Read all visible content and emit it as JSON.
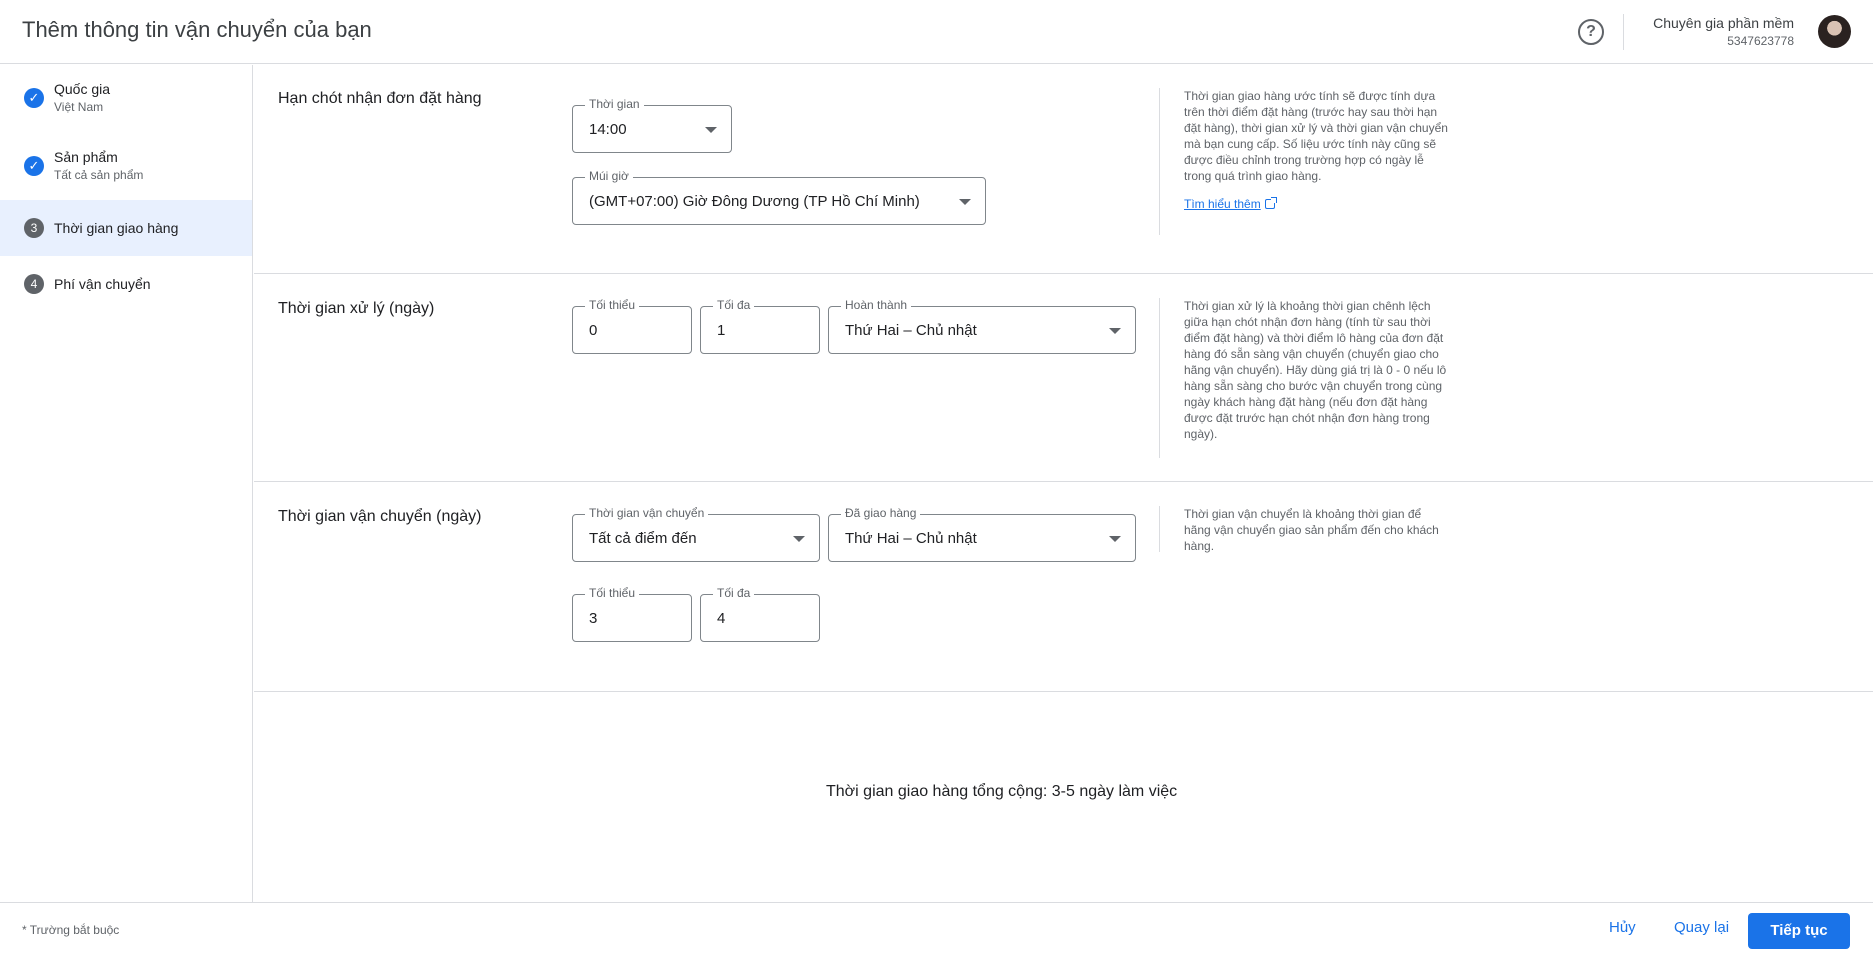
{
  "header": {
    "title": "Thêm thông tin vận chuyển của bạn",
    "help_icon": "?",
    "account_name": "Chuyên gia phần mềm",
    "account_id": "5347623778"
  },
  "sidebar": {
    "steps": [
      {
        "marker": "✓",
        "label": "Quốc gia",
        "sub": "Việt Nam",
        "status": "done"
      },
      {
        "marker": "✓",
        "label": "Sản phẩm",
        "sub": "Tất cả sản phẩm",
        "status": "done"
      },
      {
        "marker": "3",
        "label": "Thời gian giao hàng",
        "sub": "",
        "status": "active"
      },
      {
        "marker": "4",
        "label": "Phí vận chuyển",
        "sub": "",
        "status": "pending"
      }
    ]
  },
  "cutoff": {
    "title": "Hạn chót nhận đơn đặt hàng",
    "time_label": "Thời gian",
    "time_value": "14:00",
    "tz_label": "Múi giờ",
    "tz_value": "(GMT+07:00) Giờ Đông Dương (TP Hồ Chí Minh)",
    "help": "Thời gian giao hàng ước tính sẽ được tính dựa trên thời điểm đặt hàng (trước hay sau thời hạn đặt hàng), thời gian xử lý và thời gian vận chuyển mà bạn cung cấp. Số liệu ước tính này cũng sẽ được điều chỉnh trong trường hợp có ngày lễ trong quá trình giao hàng.",
    "learn_more": "Tìm hiểu thêm"
  },
  "handling": {
    "title": "Thời gian xử lý (ngày)",
    "min_label": "Tối thiểu",
    "min_value": "0",
    "max_label": "Tối đa",
    "max_value": "1",
    "days_label": "Hoàn thành",
    "days_value": "Thứ Hai – Chủ nhật",
    "help": "Thời gian xử lý là khoảng thời gian chênh lệch giữa hạn chót nhận đơn hàng (tính từ sau thời điểm đặt hàng) và thời điểm lô hàng của đơn đặt hàng đó sẵn sàng vận chuyển (chuyển giao cho hãng vận chuyển). Hãy dùng giá trị là 0 - 0 nếu lô hàng sẵn sàng cho bước vận chuyển trong cùng ngày khách hàng đặt hàng (nếu đơn đặt hàng được đặt trước hạn chót nhận đơn hàng trong ngày)."
  },
  "transit": {
    "title": "Thời gian vận chuyển (ngày)",
    "dest_label": "Thời gian vận chuyển",
    "dest_value": "Tất cả điểm đến",
    "days_label": "Đã giao hàng",
    "days_value": "Thứ Hai – Chủ nhật",
    "min_label": "Tối thiểu",
    "min_value": "3",
    "max_label": "Tối đa",
    "max_value": "4",
    "help": "Thời gian vận chuyển là khoảng thời gian để hãng vận chuyển giao sản phẩm đến cho khách hàng."
  },
  "summary": {
    "total": "Thời gian giao hàng tổng cộng: 3-5 ngày làm việc"
  },
  "footer": {
    "required_note": "* Trường bắt buộc",
    "cancel": "Hủy",
    "back": "Quay lại",
    "next": "Tiếp tục"
  },
  "colors": {
    "accent": "#1a73e8",
    "active_step_bg": "#e8f0fe",
    "border": "#dadce0"
  }
}
